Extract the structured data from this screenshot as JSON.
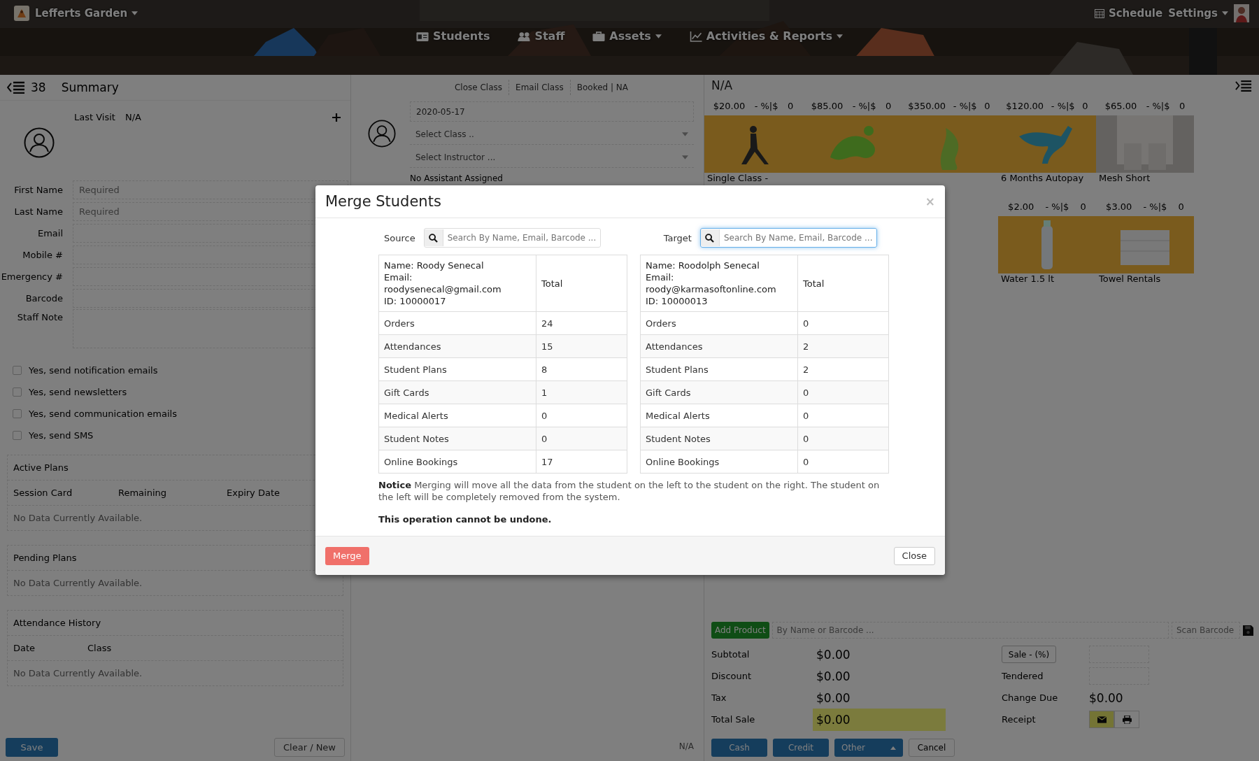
{
  "header": {
    "studio": "Lefferts Garden",
    "nav": [
      {
        "label": "Students",
        "dropdown": false
      },
      {
        "label": "Staff",
        "dropdown": false
      },
      {
        "label": "Assets",
        "dropdown": true
      },
      {
        "label": "Activities & Reports",
        "dropdown": true
      }
    ],
    "schedule": "Schedule",
    "settings": "Settings"
  },
  "student": {
    "count": "38",
    "title": "Summary",
    "last_visit_label": "Last Visit",
    "last_visit": "N/A",
    "fields": [
      {
        "label": "First Name",
        "placeholder": "Required",
        "kind": "input"
      },
      {
        "label": "Last Name",
        "placeholder": "Required",
        "kind": "input"
      },
      {
        "label": "Email",
        "kind": "input"
      },
      {
        "label": "Mobile #",
        "kind": "input"
      },
      {
        "label": "Emergency #",
        "kind": "input"
      },
      {
        "label": "Barcode",
        "kind": "input"
      },
      {
        "label": "Staff Note",
        "kind": "textarea"
      }
    ],
    "options": [
      {
        "label": "Yes, send notification emails",
        "checked": false
      },
      {
        "label": "Yes, send newsletters",
        "checked": false
      },
      {
        "label": "Yes, send communication emails",
        "checked": false
      },
      {
        "label": "Yes, send SMS",
        "checked": false
      }
    ],
    "sections": [
      {
        "title": "Active Plans",
        "columns": [
          "Session Card",
          "Remaining",
          "Expiry Date"
        ],
        "empty": "No Data Currently Available."
      },
      {
        "title": "Pending Plans",
        "empty": "No Data Currently Available."
      },
      {
        "title": "Attendance History",
        "columns": [
          "Date",
          "Class"
        ],
        "empty": "No Data Currently Available."
      }
    ],
    "buttons": [
      "Save",
      "Clear / New"
    ]
  },
  "class": {
    "tabs": [
      "Close Class",
      "Email Class",
      "Booked | NA"
    ],
    "date": "2020-05-17",
    "class_placeholder": "Select Class ..",
    "instructor_placeholder": "Select Instructor ...",
    "assistant": "No Assistant Assigned",
    "footer": "N/A"
  },
  "pos": {
    "title": "N/A",
    "product_rows": [
      [
        {
          "price": "$20.00",
          "discount": "- %|$",
          "count": "0",
          "name": "Single Class -",
          "kind": "picture"
        },
        {
          "price": "$85.00",
          "discount": "- %|$",
          "count": "0",
          "kind": "picture"
        },
        {
          "price": "$350.00",
          "discount": "- %|$",
          "count": "0",
          "kind": "picture"
        },
        {
          "price": "$120.00",
          "discount": "- %|$",
          "count": "0",
          "name": "6 Months Autopay",
          "kind": "picture"
        },
        {
          "price": "$65.00",
          "discount": "- %|$",
          "count": "0",
          "name": "Mesh Short",
          "kind": "picture"
        }
      ],
      [
        {
          "price": "$2.00",
          "discount": "- %|$",
          "count": "0",
          "name": "Water 1.5 lt",
          "kind": "picture"
        },
        {
          "price": "$3.00",
          "discount": "- %|$",
          "count": "0",
          "name": "Towel Rentals",
          "kind": "picture"
        }
      ]
    ],
    "add_product": "Add Product",
    "product_placeholder": "By Name or Barcode ...",
    "scan_placeholder": "Scan Barcode",
    "totals": [
      {
        "label": "Subtotal",
        "value": "$0.00"
      },
      {
        "label": "Discount",
        "value": "$0.00"
      },
      {
        "label": "Tax",
        "value": "$0.00"
      },
      {
        "label": "Total Sale",
        "value": "$0.00"
      }
    ],
    "sale_button": "Sale - (%)",
    "tendered": "Tendered",
    "change_due": "Change Due",
    "change_value": "$0.00",
    "receipt": "Receipt",
    "pay_buttons": [
      {
        "label": "Cash",
        "kind": "pay"
      },
      {
        "label": "Credit",
        "kind": "pay"
      },
      {
        "label": "Other",
        "kind": "dropdown"
      },
      {
        "label": "Cancel",
        "kind": "cancel"
      }
    ]
  },
  "modal": {
    "title": "Merge Students",
    "close_glyph": "×",
    "sides": [
      {
        "label": "Source",
        "placeholder": "Search By Name, Email, Barcode ...",
        "focused": false,
        "lines": [
          "Name: Roody Senecal",
          "Email: roodysenecal@gmail.com",
          "ID: 10000017"
        ],
        "total": "Total",
        "rows": [
          [
            "Orders",
            "24"
          ],
          [
            "Attendances",
            "15"
          ],
          [
            "Student Plans",
            "8"
          ],
          [
            "Gift Cards",
            "1"
          ],
          [
            "Medical Alerts",
            "0"
          ],
          [
            "Student Notes",
            "0"
          ],
          [
            "Online Bookings",
            "17"
          ]
        ]
      },
      {
        "label": "Target",
        "placeholder": "Search By Name, Email, Barcode ...",
        "focused": true,
        "lines": [
          "Name: Roodolph Senecal",
          "Email: roody@karmasoftonline.com",
          "ID: 10000013"
        ],
        "total": "Total",
        "rows": [
          [
            "Orders",
            "0"
          ],
          [
            "Attendances",
            "2"
          ],
          [
            "Student Plans",
            "2"
          ],
          [
            "Gift Cards",
            "0"
          ],
          [
            "Medical Alerts",
            "0"
          ],
          [
            "Student Notes",
            "0"
          ],
          [
            "Online Bookings",
            "0"
          ]
        ]
      }
    ],
    "notice": "**Notice** Merging will move all the data from the student on the left to the student on the right. The student on the left will be completely removed from the system.",
    "warning": "This operation cannot be undone.",
    "merge": "Merge",
    "close": "Close"
  }
}
